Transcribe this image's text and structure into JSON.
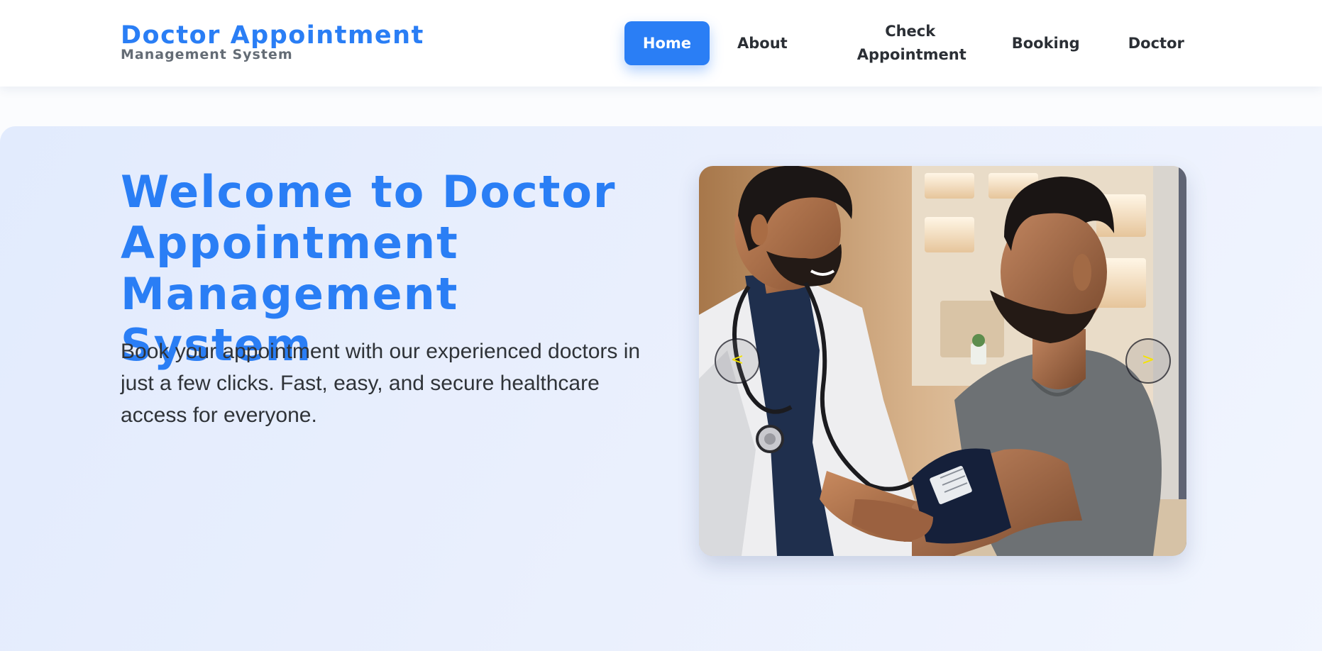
{
  "header": {
    "brand_title": "Doctor Appointment",
    "brand_subtitle": "Management System",
    "nav": {
      "home": "Home",
      "about": "About",
      "check_line1": "Check",
      "check_line2": "Appointment",
      "booking": "Booking",
      "doctor": "Doctor"
    },
    "accent_color": "#2a7ef5"
  },
  "hero": {
    "title": "Welcome to Doctor Appointment Management System",
    "description": "Book your appointment with our experienced doctors in just a few clicks. Fast, easy, and secure healthcare access for everyone.",
    "carousel": {
      "prev_label": "<",
      "next_label": ">",
      "image_subject": "doctor-measuring-patient-blood-pressure"
    }
  }
}
